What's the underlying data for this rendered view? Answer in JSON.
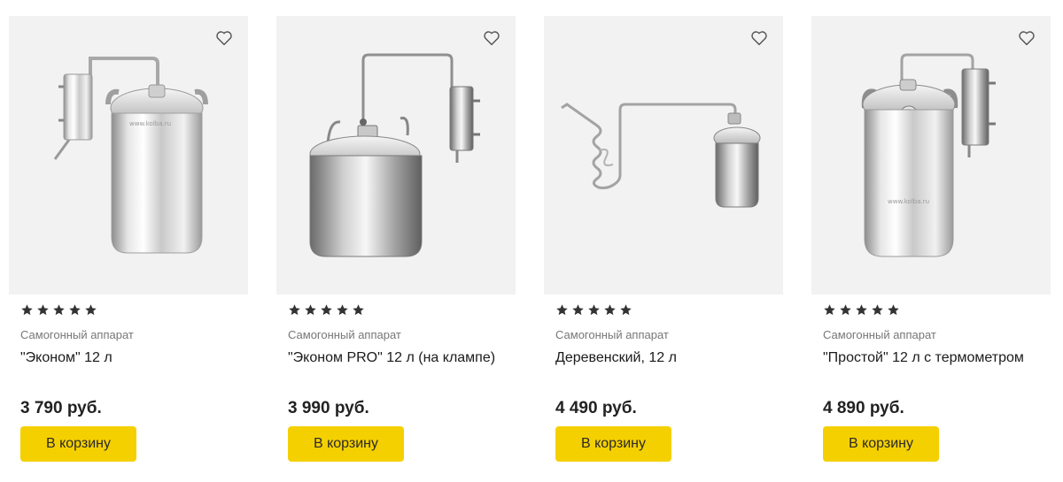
{
  "products": [
    {
      "category": "Самогонный аппарат",
      "title": "\"Эконом\" 12 л",
      "price": "3 790 руб.",
      "rating": 5,
      "button": "В корзину",
      "watermark": "www.kolba.ru"
    },
    {
      "category": "Самогонный аппарат",
      "title": "\"Эконом PRO\" 12 л (на клампе)",
      "price": "3 990 руб.",
      "rating": 5,
      "button": "В корзину"
    },
    {
      "category": "Самогонный аппарат",
      "title": "Деревенский, 12 л",
      "price": "4 490 руб.",
      "rating": 5,
      "button": "В корзину"
    },
    {
      "category": "Самогонный аппарат",
      "title": "\"Простой\" 12 л с термометром",
      "price": "4 890 руб.",
      "rating": 5,
      "button": "В корзину",
      "watermark": "www.kolba.ru"
    }
  ],
  "icons": {
    "favorite": "heart-outline-icon",
    "rating": "star-icon"
  },
  "colors": {
    "button": "#f5d000",
    "image_bg": "#f2f2f2",
    "star": "#333333"
  }
}
